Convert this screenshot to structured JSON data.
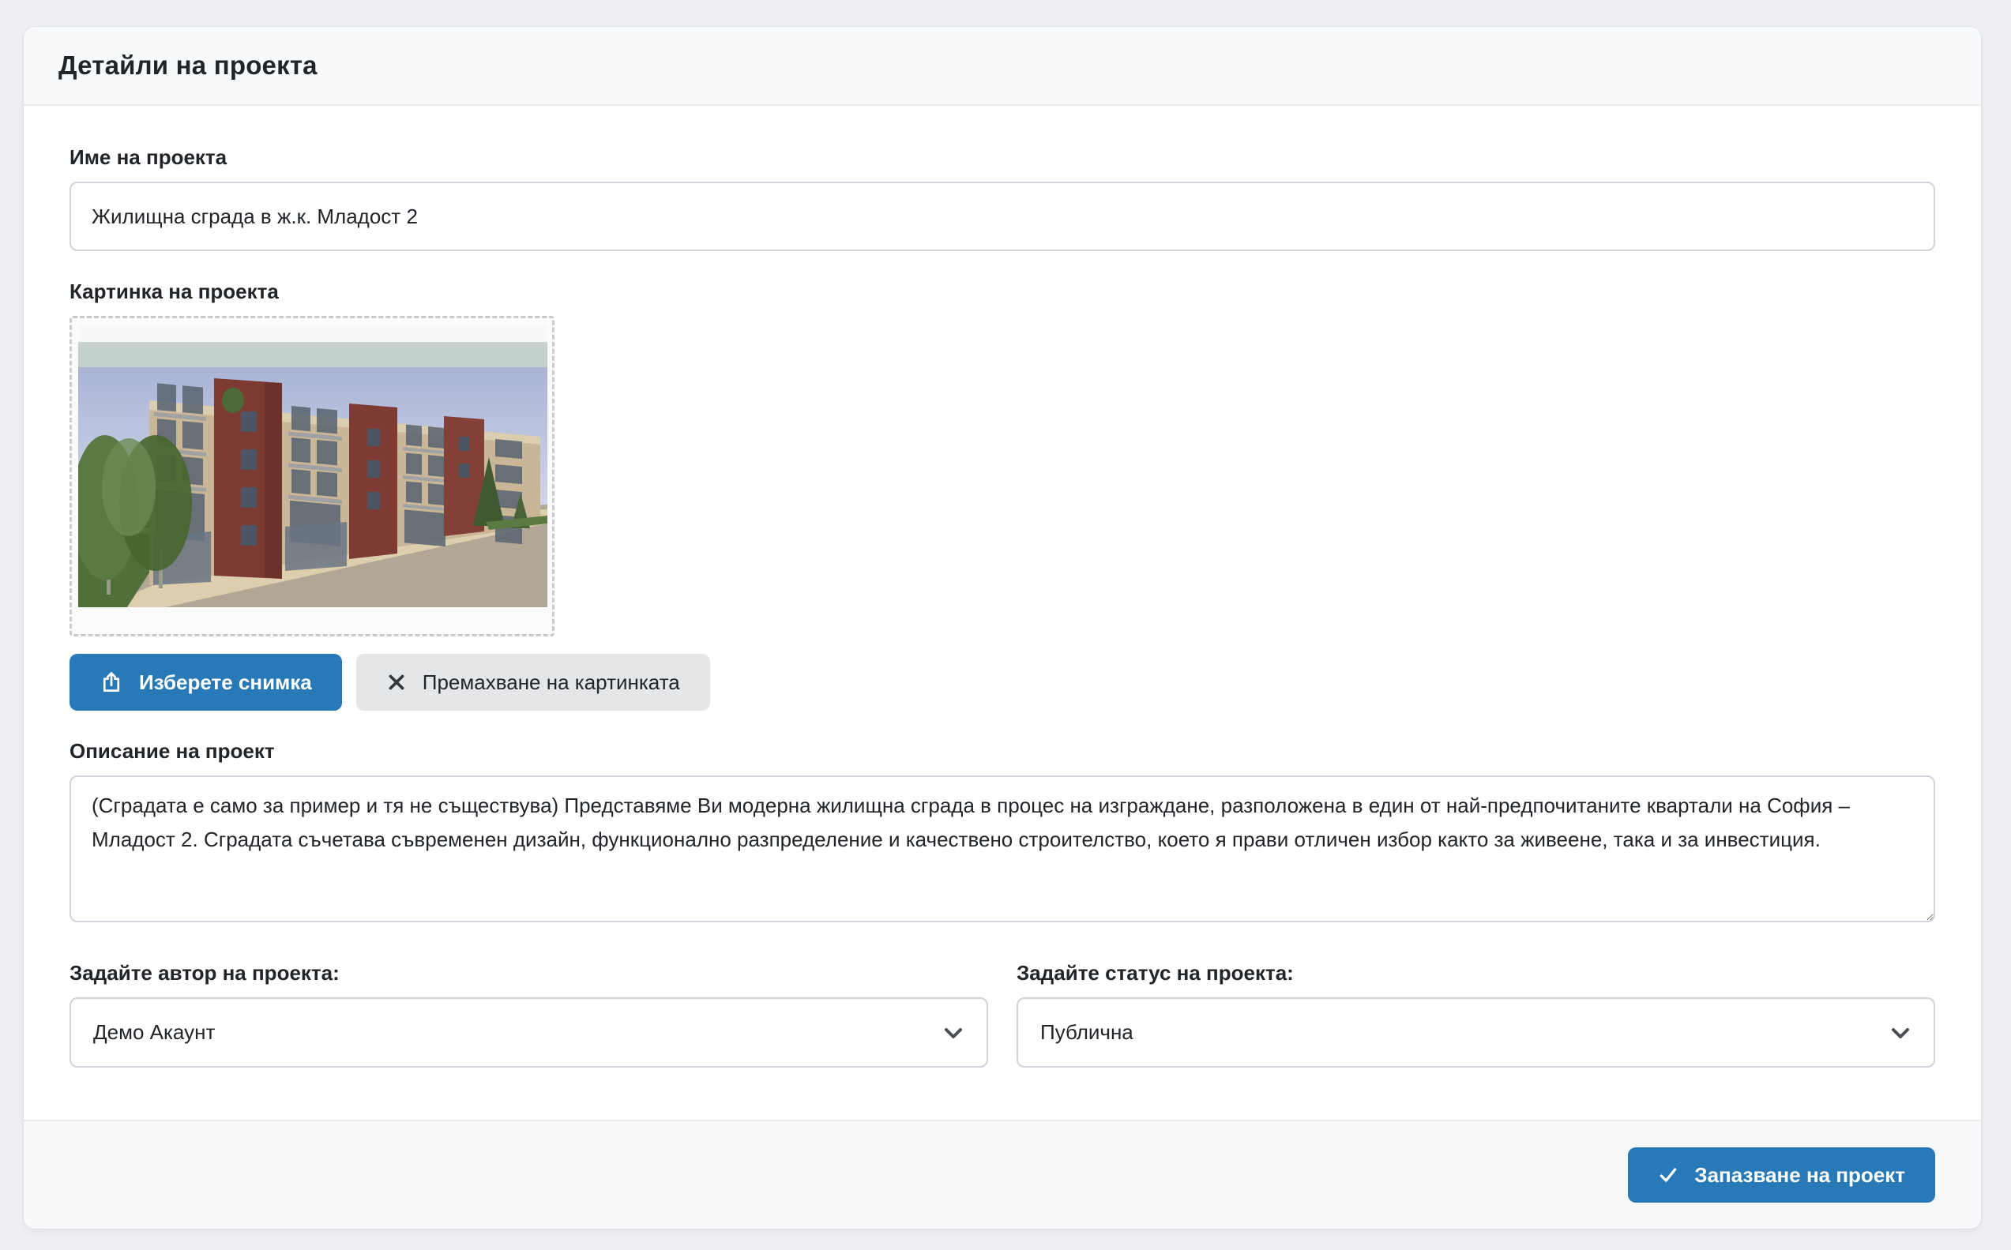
{
  "card": {
    "header": {
      "title": "Детайли на проекта"
    },
    "form": {
      "name_field": {
        "label": "Име на проекта",
        "value": "Жилищна сграда в ж.к. Младост 2"
      },
      "image_field": {
        "label": "Картинка на проекта",
        "preview": "render of a five-storey residential building with dark-red stair towers, trees on the left and a paved street",
        "choose_button": "Изберете снимка",
        "remove_button": "Премахване на картинката"
      },
      "description_field": {
        "label": "Описание на проект",
        "value": "(Сградата е само за пример и тя не съществува) Представяме Ви модерна жилищна сграда в процес на изграждане, разположена в един от най-предпочитаните квартали на София – Младост 2. Сградата съчетава съвременен дизайн, функционално разпределение и качествено строителство, което я прави отличен избор както за живеене, така и за инвестиция."
      },
      "author_field": {
        "label": "Задайте автор на проекта:",
        "value": "Демо Акаунт"
      },
      "status_field": {
        "label": "Задайте статус на проекта:",
        "value": "Публична"
      }
    },
    "footer": {
      "save_button": "Запазване на проект"
    }
  },
  "icons": {
    "choose": "upload-icon",
    "remove": "x-icon",
    "save": "check-icon",
    "selects": "chevron-down-icon"
  },
  "colors": {
    "primary_blue": "#2779b7",
    "secondary_gray": "#e4e6e8",
    "page_background": "#edeff2",
    "panel_background": "#f8f9fa",
    "input_border": "#cfd4da",
    "text": "#212529"
  }
}
